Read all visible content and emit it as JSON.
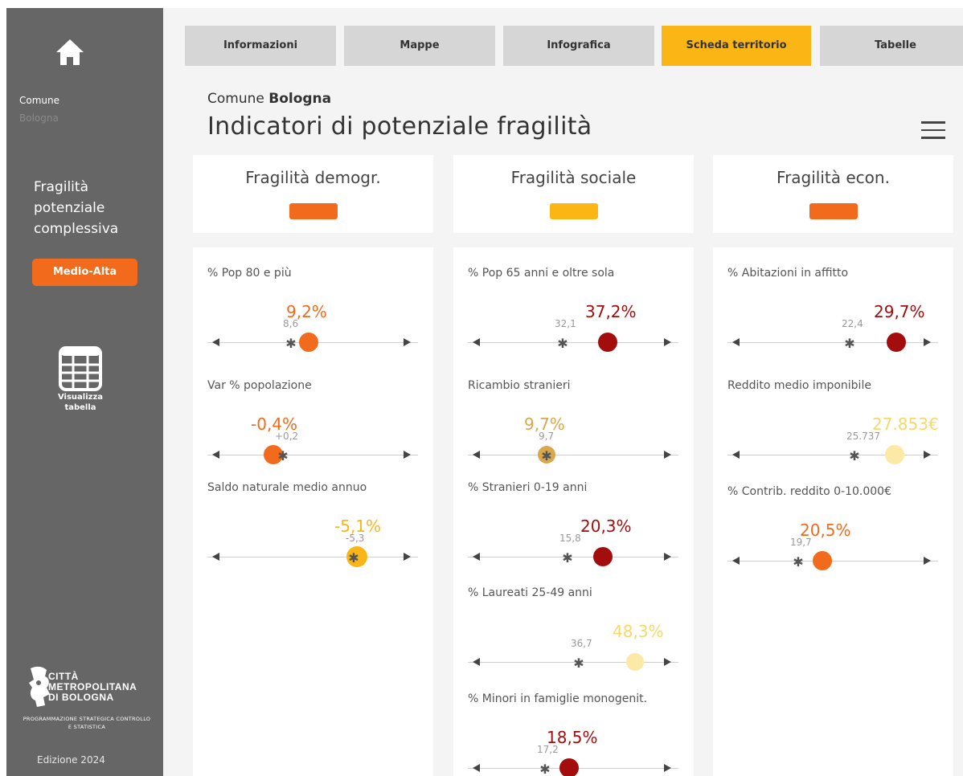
{
  "sidebar": {
    "comune_label": "Comune",
    "comune_value": "Bologna",
    "fragility_title": "Fragilità potenziale complessiva",
    "fragility_level": "Medio-Alta",
    "fragility_color": "#f26a1b",
    "table_button_label": "Visualizza tabella",
    "logo_text": "CITTÀ METROPOLITANA DI BOLOGNA",
    "logo_subtext": "PROGRAMMAZIONE STRATEGICA CONTROLLO E STATISTICA",
    "edition": "Edizione 2024"
  },
  "tabs": [
    {
      "label": "Informazioni",
      "active": false
    },
    {
      "label": "Mappe",
      "active": false
    },
    {
      "label": "Infografica",
      "active": false
    },
    {
      "label": "Scheda territorio",
      "active": true
    },
    {
      "label": "Tabelle",
      "active": false
    }
  ],
  "header": {
    "breadcrumb_prefix": "Comune",
    "breadcrumb_name": "Bologna",
    "title": "Indicatori di potenziale fragilità"
  },
  "categories": [
    {
      "title": "Fragilità demogr.",
      "color": "#f26a1b"
    },
    {
      "title": "Fragilità sociale",
      "color": "#fbb615"
    },
    {
      "title": "Fragilità econ.",
      "color": "#f26a1b"
    }
  ],
  "indicators": {
    "demografica": [
      {
        "label": "% Pop 80 e più",
        "value": "9,2%",
        "reference": "8,6",
        "color": "#f26a1b"
      },
      {
        "label": "Var % popolazione",
        "value": "-0,4%",
        "reference": "+0,2",
        "color": "#f26a1b"
      },
      {
        "label": "Saldo naturale medio annuo",
        "value": "-5,1%",
        "reference": "-5,3",
        "color": "#fbb615"
      }
    ],
    "sociale": [
      {
        "label": "% Pop 65 anni e oltre sola",
        "value": "37,2%",
        "reference": "32,1",
        "color": "#a30d0d"
      },
      {
        "label": "Ricambio stranieri",
        "value": "9,7%",
        "reference": "9,7",
        "color": "#d9a84b"
      },
      {
        "label": "% Stranieri 0-19 anni",
        "value": "20,3%",
        "reference": "15,8",
        "color": "#a30d0d"
      },
      {
        "label": "% Laureati 25-49 anni",
        "value": "48,3%",
        "reference": "36,7",
        "color": "#fce9a6"
      },
      {
        "label": "% Minori in famiglie monogenit.",
        "value": "18,5%",
        "reference": "17,2",
        "color": "#a30d0d"
      }
    ],
    "economica": [
      {
        "label": "% Abitazioni in affitto",
        "value": "29,7%",
        "reference": "22,4",
        "color": "#a30d0d"
      },
      {
        "label": "Reddito medio imponibile",
        "value": "27.853€",
        "reference": "25.737",
        "color": "#fce9a6"
      },
      {
        "label": "% Contrib. reddito 0-10.000€",
        "value": "20,5%",
        "reference": "19,7",
        "color": "#f26a1b"
      }
    ]
  }
}
